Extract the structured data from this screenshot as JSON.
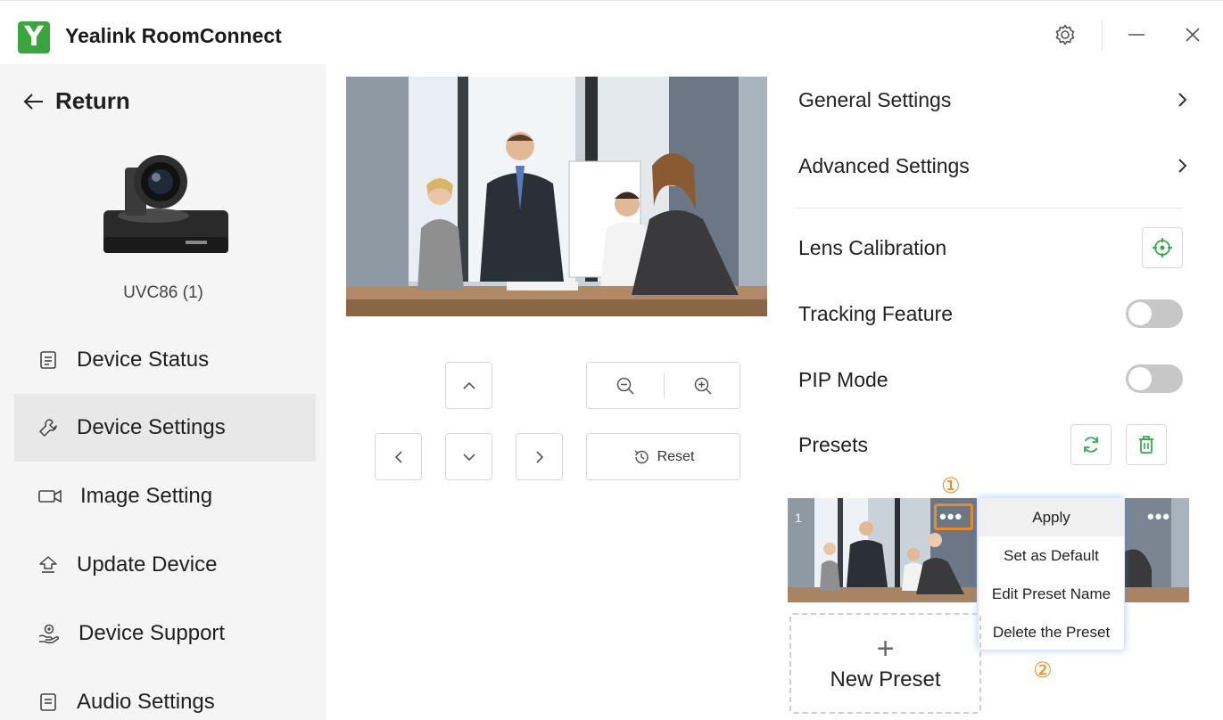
{
  "app": {
    "logo_letter": "Y",
    "title": "Yealink RoomConnect"
  },
  "window": {
    "settings_icon": "gear-icon",
    "minimize_icon": "minimize-icon",
    "close_icon": "close-icon"
  },
  "sidebar": {
    "return_label": "Return",
    "device_name": "UVC86 (1)",
    "items": [
      {
        "label": "Device Status",
        "icon": "document-icon"
      },
      {
        "label": "Device Settings",
        "icon": "wrench-icon",
        "active": true
      },
      {
        "label": "Image Setting",
        "icon": "video-camera-icon"
      },
      {
        "label": "Update Device",
        "icon": "upload-icon"
      },
      {
        "label": "Device Support",
        "icon": "support-icon"
      },
      {
        "label": "Audio Settings",
        "icon": "document-icon"
      }
    ]
  },
  "camera": {
    "reset_label": "Reset"
  },
  "settings": {
    "general": "General Settings",
    "advanced": "Advanced Settings",
    "lens_calibration": "Lens Calibration",
    "tracking_feature": "Tracking Feature",
    "tracking_on": false,
    "pip_mode": "PIP Mode",
    "pip_on": false,
    "presets": "Presets"
  },
  "presets": {
    "first_number": "1",
    "annotation_1": "①",
    "annotation_2": "②",
    "menu": [
      "Apply",
      "Set as Default",
      "Edit Preset Name",
      "Delete the Preset"
    ],
    "new_preset": "New Preset",
    "new_preset_plus": "+"
  },
  "colors": {
    "brand_green": "#3aa53f",
    "highlight_orange": "#f08a24",
    "icon_green": "#2fae4a"
  }
}
